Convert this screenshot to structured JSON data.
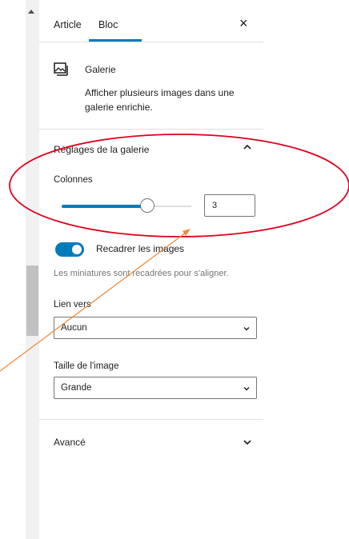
{
  "tabs": [
    {
      "label": "Article",
      "active": false
    },
    {
      "label": "Bloc",
      "active": true
    }
  ],
  "block": {
    "icon": "gallery-icon",
    "title": "Galerie",
    "description": "Afficher plusieurs images dans une galerie enrichie."
  },
  "gallery_settings": {
    "title": "Réglages de la galerie",
    "expanded": true,
    "columns": {
      "label": "Colonnes",
      "value": "3",
      "slider_fraction": 0.67
    },
    "crop": {
      "label": "Recadrer les images",
      "enabled": true,
      "help": "Les miniatures sont recadrées pour s'aligner."
    },
    "link_to": {
      "label": "Lien vers",
      "value": "Aucun"
    },
    "image_size": {
      "label": "Taille de l'image",
      "value": "Grande"
    }
  },
  "advanced": {
    "title": "Avancé",
    "expanded": false
  },
  "colors": {
    "accent": "#007cba",
    "annotation_circle": "#e0001b",
    "annotation_arrow": "#f08a3c"
  }
}
